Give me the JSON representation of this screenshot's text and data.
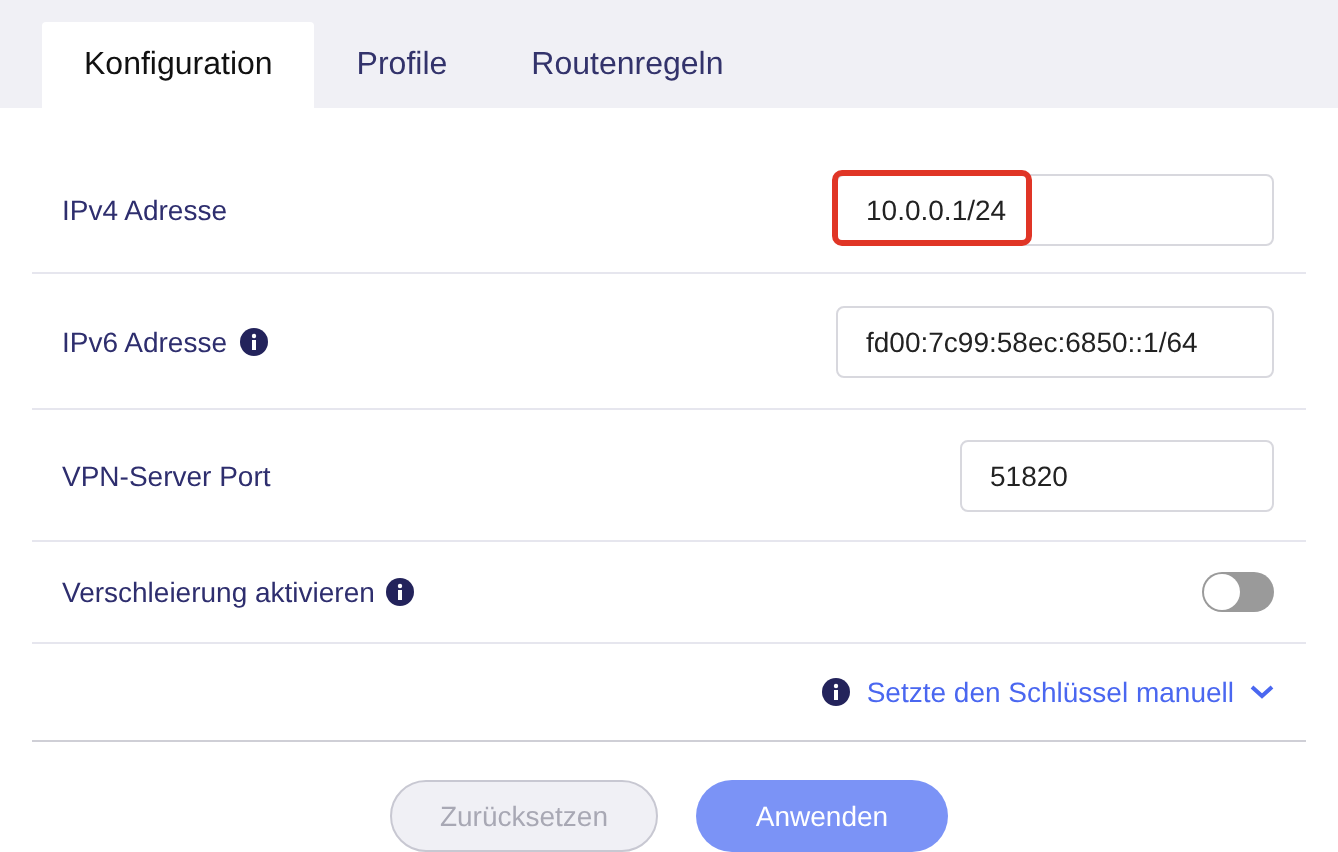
{
  "tabs": [
    {
      "label": "Konfiguration",
      "selected": true
    },
    {
      "label": "Profile",
      "selected": false
    },
    {
      "label": "Routenregeln",
      "selected": false
    }
  ],
  "rows": [
    {
      "kind": "address",
      "label": "IPv4 Adresse",
      "info": false,
      "value": "10.0.0.1/24",
      "highlighted": true
    },
    {
      "kind": "address",
      "label": "IPv6 Adresse",
      "info": true,
      "value": "fd00:7c99:58ec:6850::1/64",
      "highlighted": false
    },
    {
      "kind": "port",
      "label": "VPN-Server Port",
      "info": false,
      "value": "51820",
      "highlighted": false
    },
    {
      "kind": "toggle",
      "label": "Verschleierung aktivieren",
      "info": true,
      "on": false
    }
  ],
  "key_link": {
    "label": "Setzte den Schlüssel manuell",
    "expanded": false
  },
  "buttons": [
    {
      "label": "Zurücksetzen",
      "kind": "secondary",
      "disabled": true
    },
    {
      "label": "Anwenden",
      "kind": "primary",
      "disabled": false
    }
  ]
}
